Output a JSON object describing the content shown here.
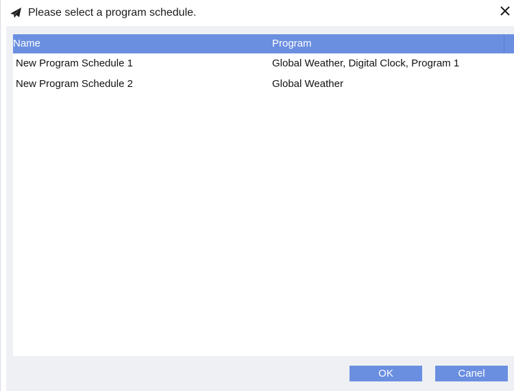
{
  "dialog": {
    "title": "Please select a program schedule.",
    "title_icon": "paper-plane-icon",
    "close_icon": "close-icon"
  },
  "table": {
    "headers": {
      "name": "Name",
      "program": "Program"
    },
    "rows": [
      {
        "name": "New Program Schedule 1",
        "program": "Global Weather, Digital Clock, Program 1"
      },
      {
        "name": "New Program Schedule 2",
        "program": "Global Weather"
      }
    ]
  },
  "buttons": {
    "ok": "OK",
    "cancel": "Canel"
  },
  "colors": {
    "accent": "#6b8fe0",
    "background": "#eef0f4"
  }
}
